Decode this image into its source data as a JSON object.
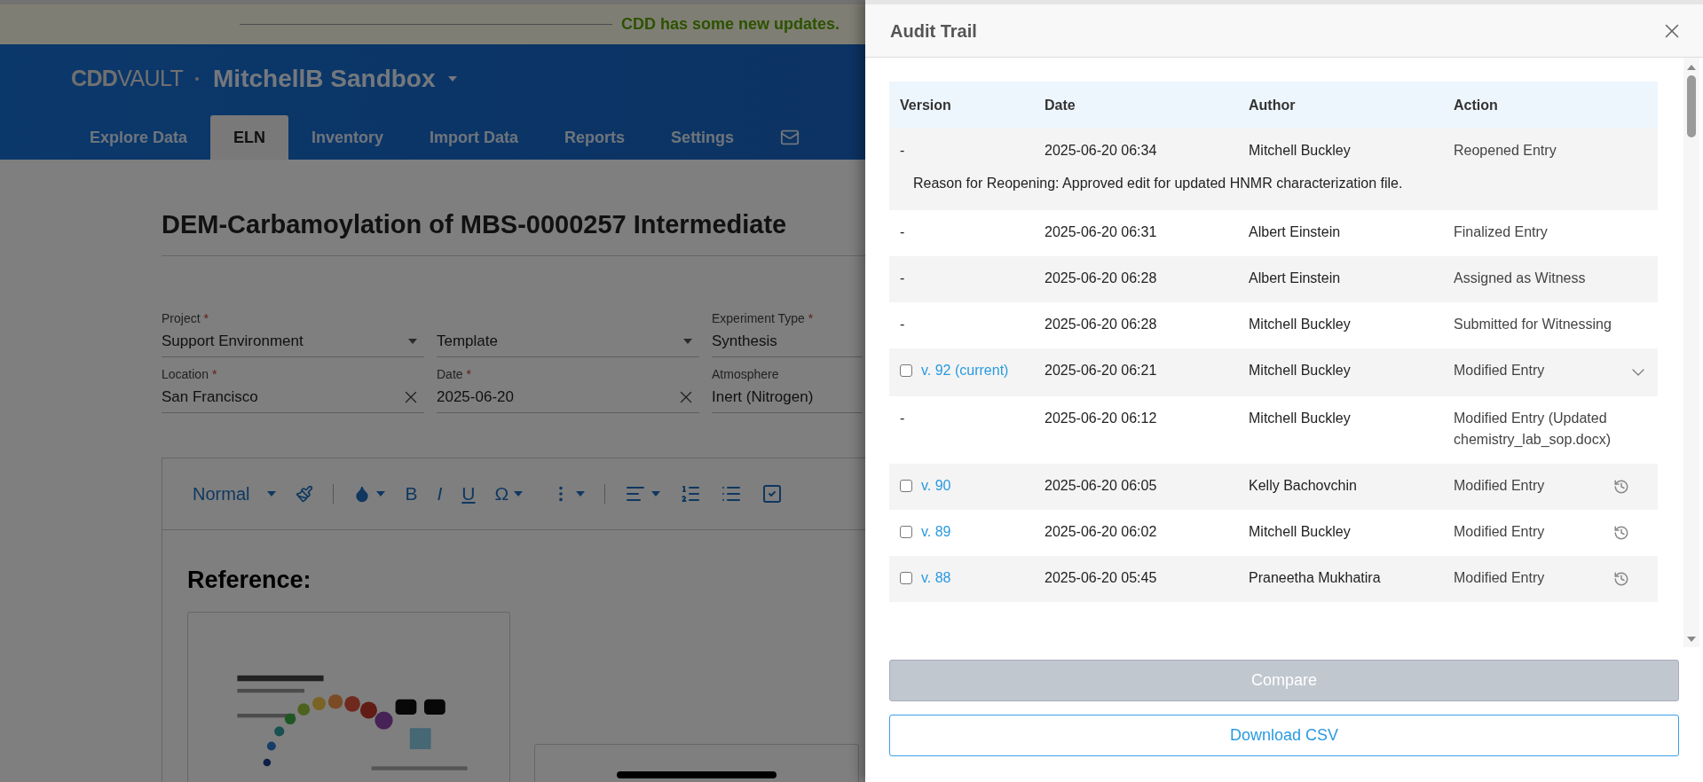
{
  "banner": {
    "text": "CDD has some new updates."
  },
  "header": {
    "logo": [
      "CDD",
      "VAULT"
    ],
    "vault_name": "MitchellB Sandbox"
  },
  "nav": [
    {
      "label": "Explore Data",
      "selected": false
    },
    {
      "label": "ELN",
      "selected": true
    },
    {
      "label": "Inventory",
      "selected": false
    },
    {
      "label": "Import Data",
      "selected": false
    },
    {
      "label": "Reports",
      "selected": false
    },
    {
      "label": "Settings",
      "selected": false
    }
  ],
  "entry": {
    "title": "DEM-Carbamoylation of MBS-0000257 Intermediate",
    "fields": [
      {
        "label": "Project",
        "marker": "*",
        "value": "Support Environment",
        "kind": "select"
      },
      {
        "value": "Template",
        "kind": "select"
      },
      {
        "label": "Experiment Type",
        "marker": "*",
        "value": "Synthesis",
        "kind": "text"
      },
      {
        "label": "Location",
        "marker": "*",
        "value": "San Francisco",
        "kind": "clear"
      },
      {
        "label": "Date",
        "marker": "*",
        "value": "2025-06-20",
        "kind": "clear"
      },
      {
        "label": "Atmosphere",
        "value": "Inert (Nitrogen)",
        "kind": "text"
      }
    ],
    "toolbar": {
      "style": "Normal",
      "letters": [
        "B",
        "I",
        "U",
        "Ω"
      ]
    },
    "heading": "Reference:"
  },
  "audit": {
    "title": "Audit Trail",
    "columns": [
      "Version",
      "Date",
      "Author",
      "Action"
    ],
    "rows": [
      {
        "kind": "event",
        "version": "-",
        "date": "2025-06-20 06:34",
        "author": "Mitchell Buckley",
        "action": "Reopened Entry",
        "note": "Reason for Reopening: Approved edit for updated HNMR characterization file."
      },
      {
        "kind": "event",
        "version": "-",
        "date": "2025-06-20 06:31",
        "author": "Albert Einstein",
        "action": "Finalized Entry"
      },
      {
        "kind": "event",
        "version": "-",
        "date": "2025-06-20 06:28",
        "author": "Albert Einstein",
        "action": "Assigned as Witness"
      },
      {
        "kind": "event",
        "version": "-",
        "date": "2025-06-20 06:28",
        "author": "Mitchell Buckley",
        "action": "Submitted for Witnessing"
      },
      {
        "kind": "expandable",
        "version": "v. 92 (current)",
        "checked": false,
        "date": "2025-06-20 06:21",
        "author": "Mitchell Buckley",
        "action": "Modified Entry"
      },
      {
        "kind": "event",
        "version": "-",
        "date": "2025-06-20 06:12",
        "author": "Mitchell Buckley",
        "action": "Modified Entry (Updated chemistry_lab_sop.docx)"
      },
      {
        "kind": "restorable",
        "version": "v. 90",
        "checked": false,
        "date": "2025-06-20 06:05",
        "author": "Kelly Bachovchin",
        "action": "Modified Entry"
      },
      {
        "kind": "restorable",
        "version": "v. 89",
        "checked": false,
        "date": "2025-06-20 06:02",
        "author": "Mitchell Buckley",
        "action": "Modified Entry"
      },
      {
        "kind": "restorable",
        "version": "v. 88",
        "checked": false,
        "date": "2025-06-20 05:45",
        "author": "Praneetha Mukhatira",
        "action": "Modified Entry"
      }
    ],
    "buttons": [
      {
        "label": "Compare",
        "disabled": true
      },
      {
        "label": "Download CSV",
        "disabled": false
      }
    ]
  }
}
